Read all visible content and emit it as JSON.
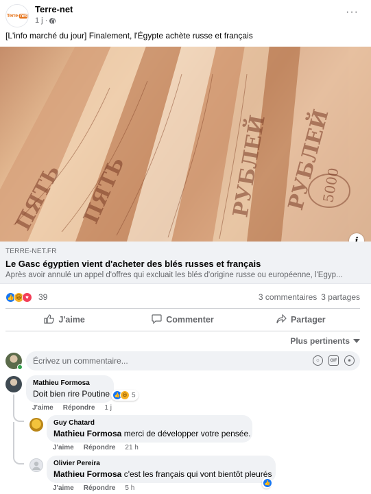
{
  "post": {
    "page_name": "Terre-net",
    "time": "1 j ·",
    "logo_text_a": "Terre-",
    "logo_text_b": "net",
    "text": "[L'info marché du jour] Finalement, l'Égypte achète russe et français"
  },
  "link": {
    "domain": "TERRE-NET.FR",
    "title": "Le Gasc égyptien vient d'acheter des blés russes et français",
    "description": "Après avoir annulé un appel d'offres qui excluait les blés d'origine russe ou européenne, l'Égyp..."
  },
  "reactions": {
    "count": "39",
    "comments": "3 commentaires",
    "shares": "3 partages",
    "types": [
      "like-icon",
      "haha-icon",
      "love-icon"
    ]
  },
  "actions": {
    "like": "J'aime",
    "comment": "Commenter",
    "share": "Partager"
  },
  "sort_label": "Plus pertinents",
  "comment_input": {
    "placeholder": "Écrivez un commentaire..."
  },
  "comments": [
    {
      "author": "Mathieu Formosa",
      "mention": "",
      "text": "Doit bien rire Poutine",
      "like": "J'aime",
      "reply": "Répondre",
      "time": "1 j",
      "reaction_count": "5"
    },
    {
      "author": "Guy Chatard",
      "mention": "Mathieu Formosa",
      "text": "merci de développer votre pensée.",
      "like": "J'aime",
      "reply": "Répondre",
      "time": "21 h"
    },
    {
      "author": "Olivier Pereira",
      "mention": "Mathieu Formosa",
      "text": "c'est les français qui vont bientôt pleurés",
      "like": "J'aime",
      "reply": "Répondre",
      "time": "5 h"
    }
  ],
  "colors": {
    "accent": "#1877f2",
    "secondary_text": "#65676b",
    "bubble": "#f0f2f5",
    "logo_orange": "#e5731a"
  }
}
